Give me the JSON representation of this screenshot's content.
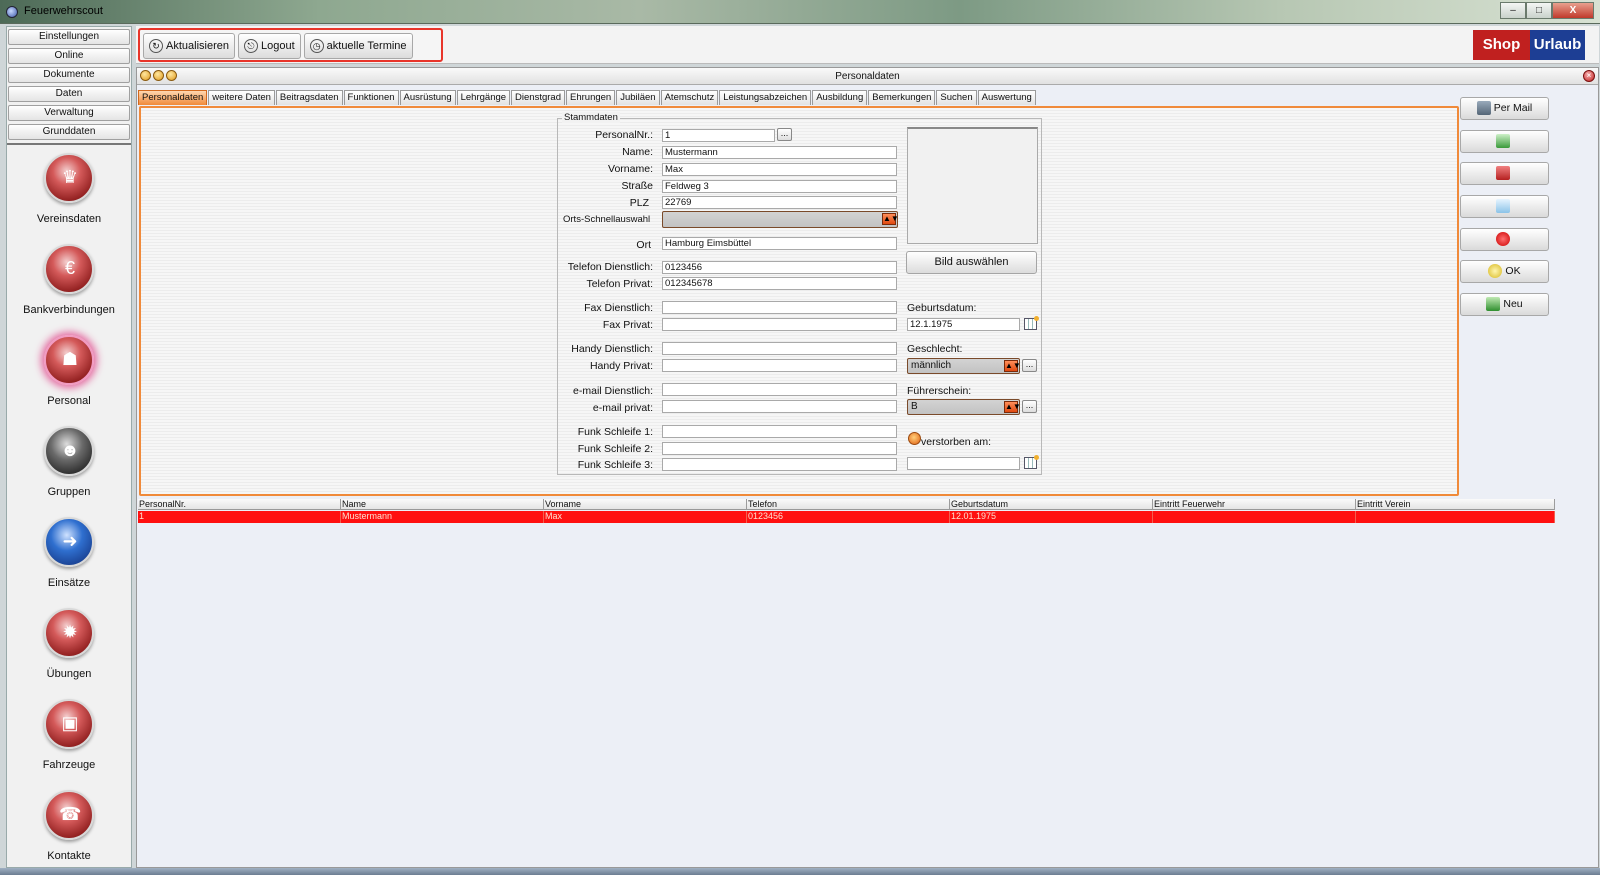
{
  "window": {
    "title": "Feuerwehrscout",
    "minimize": "–",
    "maximize": "□",
    "close": "X"
  },
  "leftnav": {
    "menu": [
      "Einstellungen",
      "Online",
      "Dokumente",
      "Daten",
      "Verwaltung",
      "Grunddaten"
    ],
    "modules": [
      {
        "label": "Vereinsdaten",
        "icon": "crown-icon"
      },
      {
        "label": "Bankverbindungen",
        "icon": "piggy-bank-icon"
      },
      {
        "label": "Personal",
        "icon": "firefighter-icon",
        "active": true
      },
      {
        "label": "Gruppen",
        "icon": "group-icon"
      },
      {
        "label": "Einsätze",
        "icon": "sign-arrow-icon"
      },
      {
        "label": "Übungen",
        "icon": "siren-icon"
      },
      {
        "label": "Fahrzeuge",
        "icon": "firetruck-icon"
      },
      {
        "label": "Kontakte",
        "icon": "contact-icon"
      }
    ]
  },
  "toolbar": {
    "refresh_label": "Aktualisieren",
    "logout_label": "Logout",
    "appointments_label": "aktuelle Termine",
    "shop": "Shop",
    "urlaub": "Urlaub"
  },
  "panel": {
    "title": "Personaldaten"
  },
  "tabs": [
    "Personaldaten",
    "weitere Daten",
    "Beitragsdaten",
    "Funktionen",
    "Ausrüstung",
    "Lehrgänge",
    "Dienstgrad",
    "Ehrungen",
    "Jubiläen",
    "Atemschutz",
    "Leistungsabzeichen",
    "Ausbildung",
    "Bemerkungen",
    "Suchen",
    "Auswertung"
  ],
  "form": {
    "legend": "Stammdaten",
    "labels": {
      "personalnr": "PersonalNr.:",
      "name": "Name:",
      "vorname": "Vorname:",
      "strasse": "Straße",
      "plz": "PLZ",
      "orts": "Orts-Schnellauswahl",
      "ort": "Ort",
      "tel_dienst": "Telefon Dienstlich:",
      "tel_privat": "Telefon Privat:",
      "fax_dienst": "Fax Dienstlich:",
      "fax_privat": "Fax Privat:",
      "handy_dienst": "Handy Dienstlich:",
      "handy_privat": "Handy Privat:",
      "mail_dienst": "e-mail Dienstlich:",
      "mail_privat": "e-mail privat:",
      "funk1": "Funk Schleife 1:",
      "funk2": "Funk Schleife 2:",
      "funk3": "Funk Schleife 3:",
      "geburtsdatum": "Geburtsdatum:",
      "geschlecht": "Geschlecht:",
      "fuehrerschein": "Führerschein:",
      "verstorben": "verstorben am:"
    },
    "values": {
      "personalnr": "1",
      "name": "Mustermann",
      "vorname": "Max",
      "strasse": "Feldweg 3",
      "plz": "22769",
      "orts": "",
      "ort": "Hamburg Eimsbüttel",
      "tel_dienst": "0123456",
      "tel_privat": "012345678",
      "fax_dienst": "",
      "fax_privat": "",
      "handy_dienst": "",
      "handy_privat": "",
      "mail_dienst": "",
      "mail_privat": "",
      "funk1": "",
      "funk2": "",
      "funk3": "",
      "geburtsdatum": "12.1.1975",
      "geschlecht": "männlich",
      "fuehrerschein": "B",
      "verstorben": ""
    },
    "dots": "...",
    "pick_image": "Bild auswählen"
  },
  "actions": {
    "mail": "Per Mail",
    "ok": "OK",
    "new": "Neu"
  },
  "grid": {
    "columns": [
      "PersonalNr.",
      "Name",
      "Vorname",
      "Telefon",
      "Geburtsdatum",
      "Eintritt Feuerwehr",
      "Eintritt Verein"
    ],
    "rows": [
      [
        "1",
        "Mustermann",
        "Max",
        "0123456",
        "12.01.1975",
        "",
        ""
      ]
    ]
  },
  "colors": {
    "accent": "#f08a3a",
    "selected_row": "#ff1010",
    "shop": "#c0201f",
    "urlaub": "#1d3e94"
  }
}
